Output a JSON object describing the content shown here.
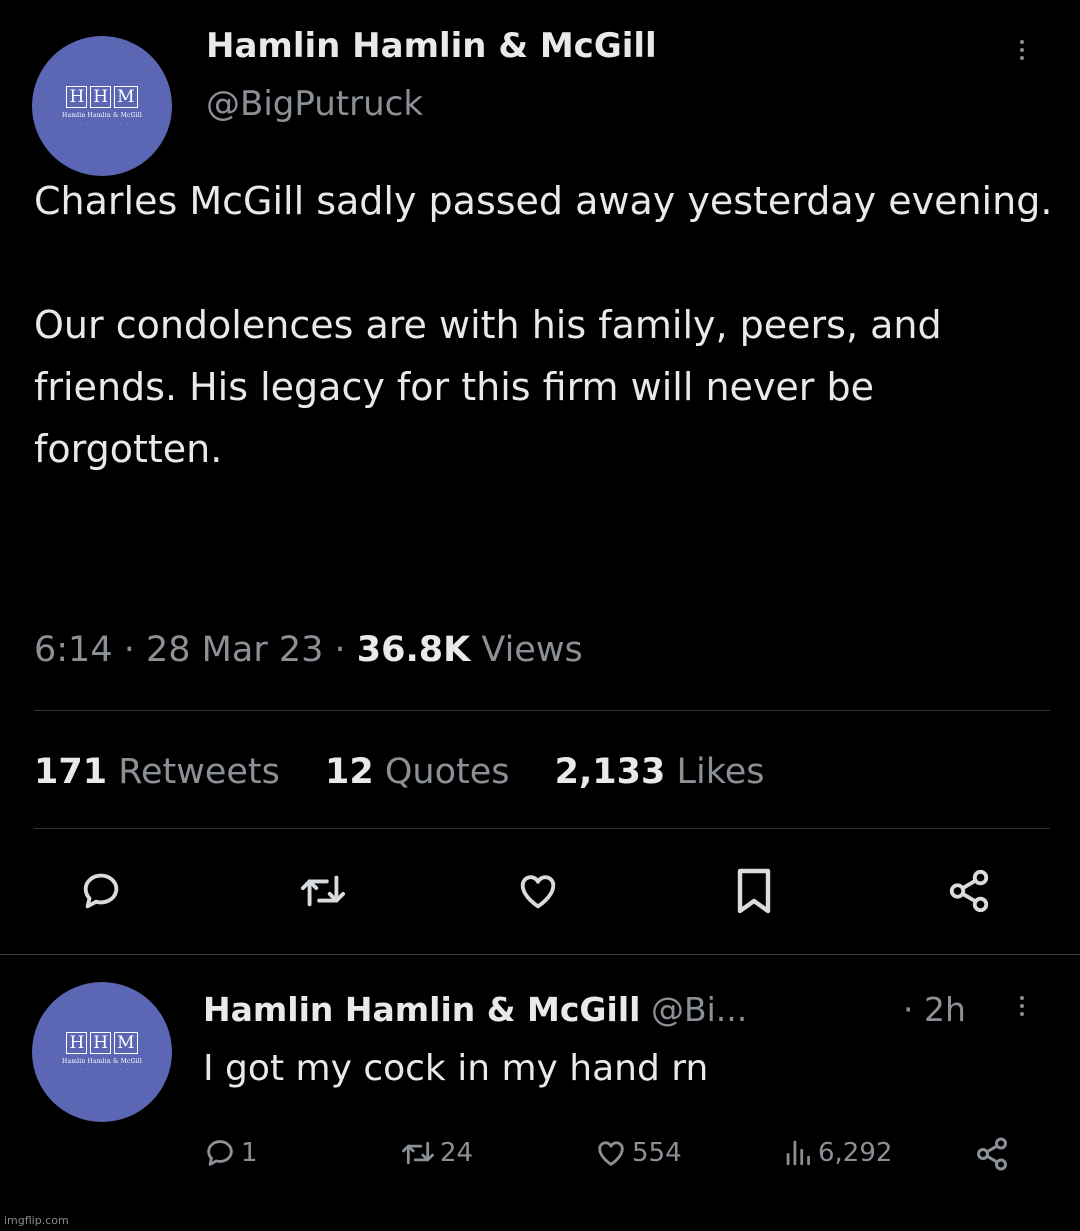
{
  "main_tweet": {
    "avatar": {
      "monogram": [
        "H",
        "H",
        "M"
      ],
      "firm_line": "Hamlin Hamlin & McGill",
      "color": "#5b67b4"
    },
    "display_name": "Hamlin Hamlin & McGill",
    "handle": "@BigPutruck",
    "text_paragraph_1": "Charles McGill sadly passed away yesterday evening.",
    "text_paragraph_2": "Our condolences are with his family, peers, and friends. His legacy for this firm will never be forgotten.",
    "time": "6:14",
    "date": "28 Mar 23",
    "views_count": "36.8K",
    "views_label": "Views",
    "retweets_count": "171",
    "retweets_label": "Retweets",
    "quotes_count": "12",
    "quotes_label": "Quotes",
    "likes_count": "2,133",
    "likes_label": "Likes",
    "actions": [
      "reply-icon",
      "retweet-icon",
      "like-icon",
      "bookmark-icon",
      "share-icon"
    ]
  },
  "reply_tweet": {
    "display_name": "Hamlin Hamlin & McGill",
    "handle": "@Bi...",
    "age": "· 2h",
    "text": "I got my cock in my hand rn",
    "replies": "1",
    "retweets": "24",
    "likes": "554",
    "views": "6,292"
  },
  "watermark": "imgflip.com",
  "colors": {
    "background": "#000000",
    "text": "#e7e9ea",
    "muted": "#8b9096",
    "divider": "#2f3336"
  }
}
